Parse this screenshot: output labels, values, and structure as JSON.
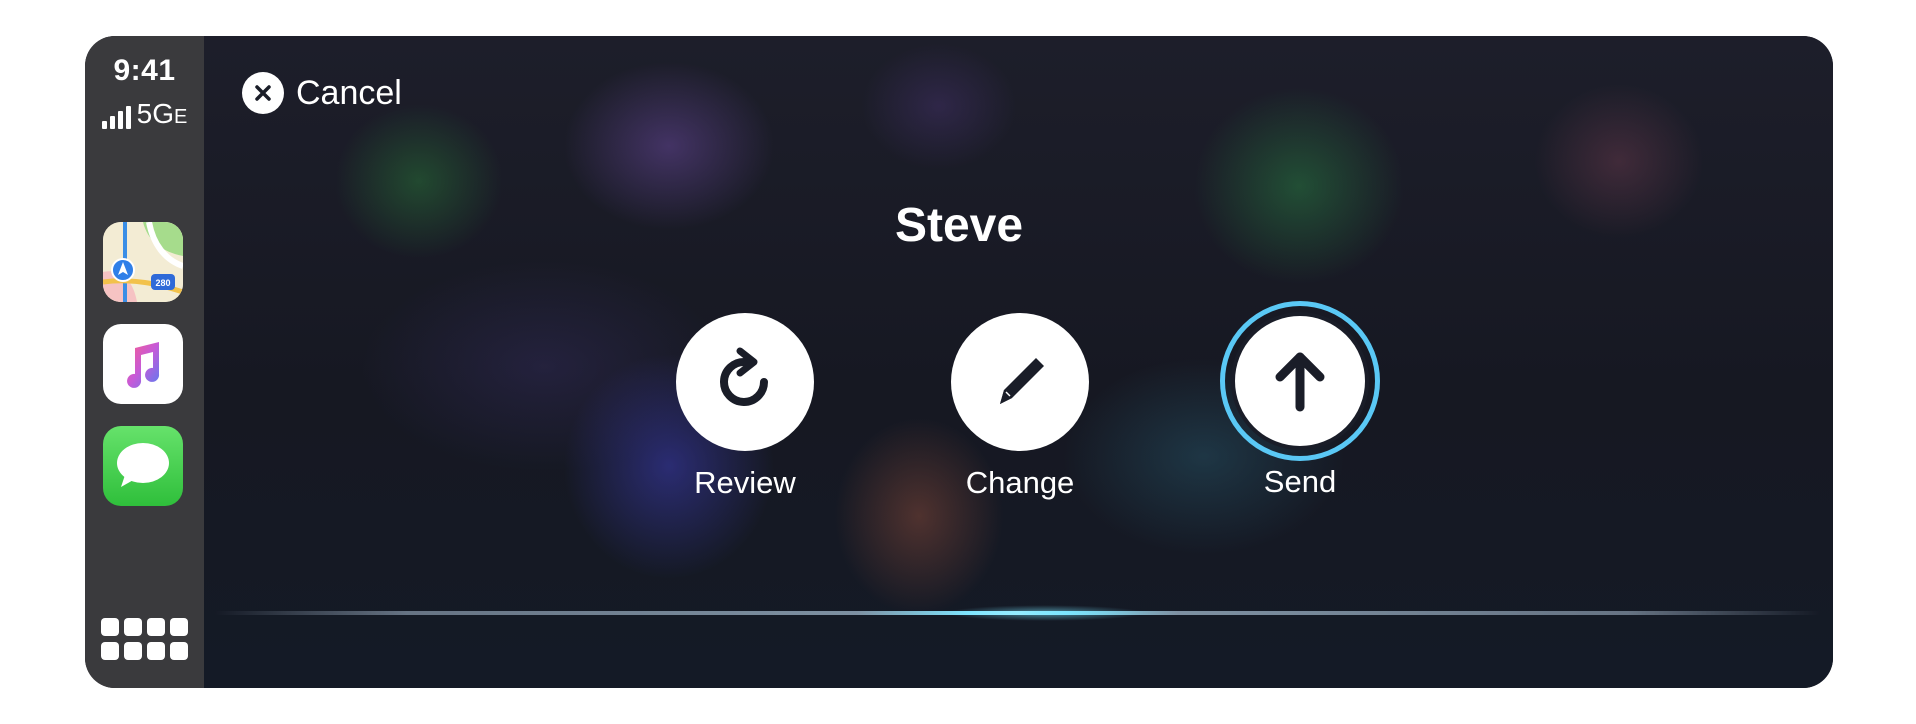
{
  "status": {
    "time": "9:41",
    "network": "5G",
    "network_suffix": "E"
  },
  "sidebar": {
    "apps": [
      {
        "name": "Maps",
        "icon": "maps-icon"
      },
      {
        "name": "Music",
        "icon": "music-icon"
      },
      {
        "name": "Messages",
        "icon": "messages-icon"
      }
    ],
    "grid_icon": "app-grid-icon"
  },
  "header": {
    "cancel_label": "Cancel",
    "cancel_icon": "close-icon"
  },
  "main": {
    "title": "Steve",
    "actions": [
      {
        "label": "Review",
        "icon": "replay-icon"
      },
      {
        "label": "Change",
        "icon": "pencil-icon"
      },
      {
        "label": "Send",
        "icon": "arrow-up-icon",
        "focused": true
      }
    ]
  },
  "colors": {
    "focus_ring": "#5ac8f5",
    "sidebar": "#3a3a3d",
    "icon_dark": "#1a1d28"
  }
}
